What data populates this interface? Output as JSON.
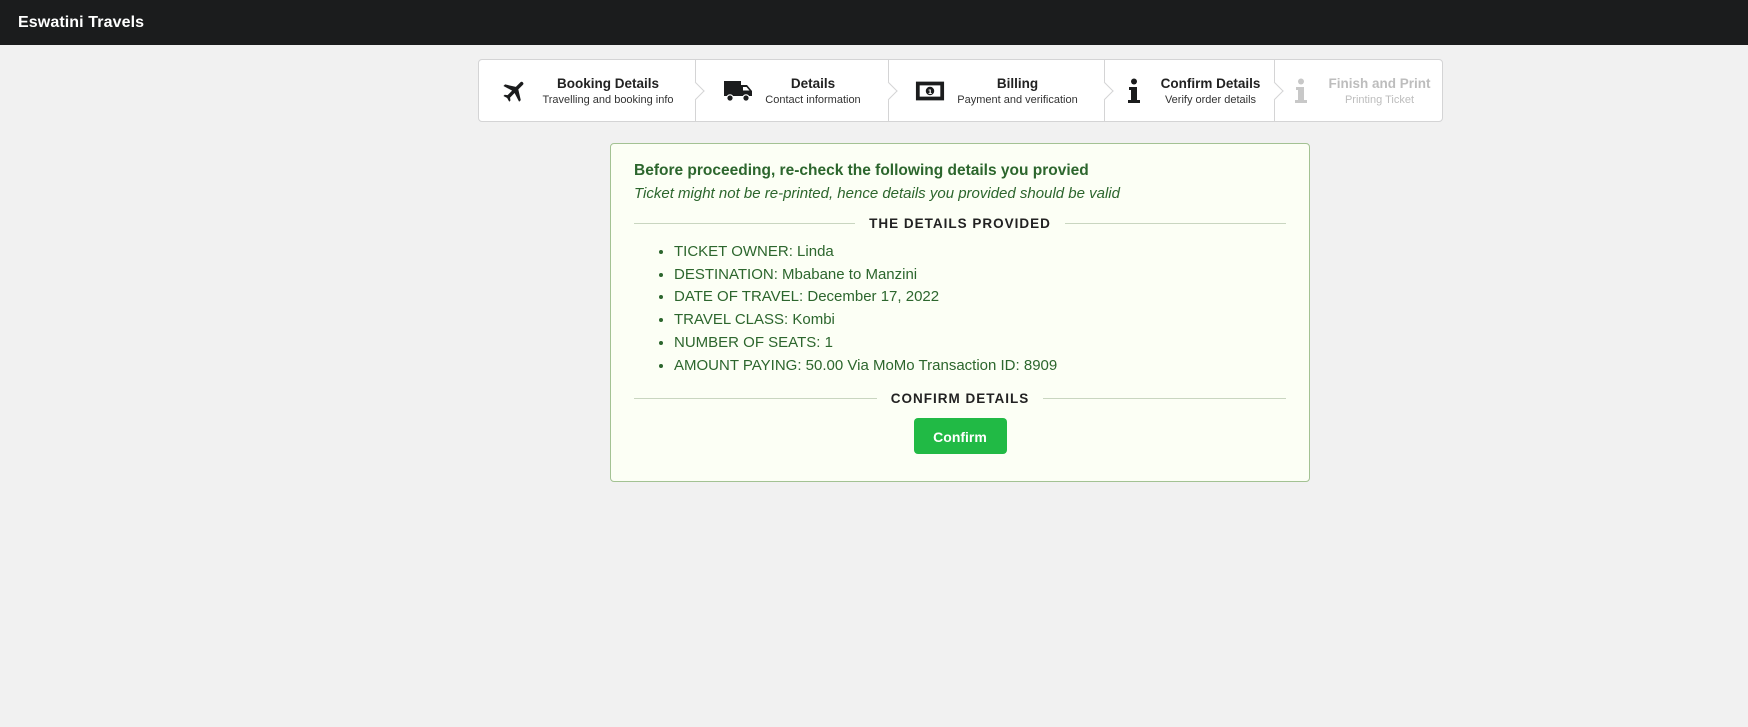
{
  "app": {
    "title": "Eswatini Travels"
  },
  "steps": [
    {
      "title": "Booking Details",
      "description": "Travelling and booking info",
      "icon": "plane-icon",
      "state": "completed"
    },
    {
      "title": "Details",
      "description": "Contact information",
      "icon": "truck-icon",
      "state": "completed"
    },
    {
      "title": "Billing",
      "description": "Payment and verification",
      "icon": "money-bill-icon",
      "state": "completed"
    },
    {
      "title": "Confirm Details",
      "description": "Verify order details",
      "icon": "info-icon",
      "state": "active"
    },
    {
      "title": "Finish and Print",
      "description": "Printing Ticket",
      "icon": "info-icon",
      "state": "disabled"
    }
  ],
  "panel": {
    "header": "Before proceeding, re-check the following details you provied",
    "subheader": "Ticket might not be re-printed, hence details you provided should be valid",
    "details_divider": "THE DETAILS PROVIDED",
    "details": [
      "TICKET OWNER: Linda",
      "DESTINATION: Mbabane to Manzini",
      "DATE OF TRAVEL: December 17, 2022",
      "TRAVEL CLASS: Kombi",
      "NUMBER OF SEATS: 1",
      "AMOUNT PAYING: 50.00 Via MoMo Transaction ID: 8909"
    ],
    "confirm_divider": "CONFIRM DETAILS",
    "confirm_button": "Confirm"
  },
  "colors": {
    "topbar": "#1b1c1d",
    "success_text": "#2c662d",
    "success_bg": "#fcfff5",
    "success_border": "#a3c293",
    "button": "#21ba45"
  }
}
